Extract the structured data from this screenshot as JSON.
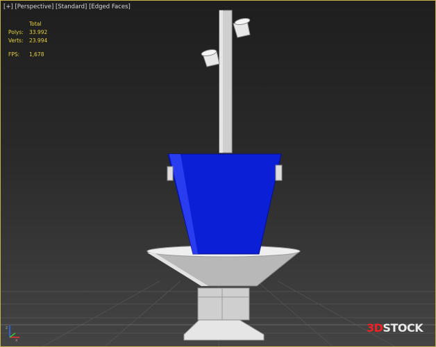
{
  "viewport": {
    "label_plus": "[+]",
    "label_view": "[Perspective]",
    "label_shading_mode": "[Standard]",
    "label_display": "[Edged Faces]",
    "border_color": "#c8b24a"
  },
  "stats": {
    "column_header": "Total",
    "polys_label": "Polys:",
    "polys_value": "33.992",
    "verts_label": "Verts:",
    "verts_value": "23.994",
    "fps_label": "FPS:",
    "fps_value": "1,678",
    "color": "#e8d23a"
  },
  "watermark": {
    "part1": "3D",
    "part2": "STOCK"
  },
  "model": {
    "bucket_color": "#0a1fd6",
    "structure_color": "#cfcfcf"
  },
  "icons": {
    "axis_tripod": "axis-tripod-icon"
  }
}
